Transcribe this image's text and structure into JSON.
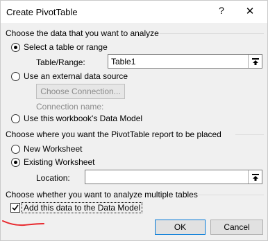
{
  "window": {
    "title": "Create PivotTable",
    "help_glyph": "?",
    "close_glyph": "✕"
  },
  "data_source": {
    "heading": "Choose the data that you want to analyze",
    "table_range_option": {
      "label": "Select a table or range",
      "selected": true
    },
    "table_range_field": {
      "label": "Table/Range:",
      "value": "Table1"
    },
    "external_option": {
      "label": "Use an external data source",
      "selected": false
    },
    "choose_connection_button": "Choose Connection...",
    "connection_name_label": "Connection name:",
    "data_model_option": {
      "label": "Use this workbook's Data Model",
      "selected": false
    }
  },
  "placement": {
    "heading": "Choose where you want the PivotTable report to be placed",
    "new_worksheet_option": {
      "label": "New Worksheet",
      "selected": false
    },
    "existing_worksheet_option": {
      "label": "Existing Worksheet",
      "selected": true
    },
    "location_field": {
      "label": "Location:",
      "value": ""
    }
  },
  "multiple_tables": {
    "heading": "Choose whether you want to analyze multiple tables",
    "add_to_data_model": {
      "label": "Add this data to the Data Model",
      "checked": true
    }
  },
  "footer": {
    "ok_label": "OK",
    "cancel_label": "Cancel"
  },
  "colors": {
    "annotation_stroke": "#e8262b",
    "dialog_background": "#f0f0f0",
    "focus_border": "#0078d7"
  },
  "icons": {
    "range_collapse": "collapse-arrow-icon",
    "checkbox_mark": "checkmark-icon"
  }
}
